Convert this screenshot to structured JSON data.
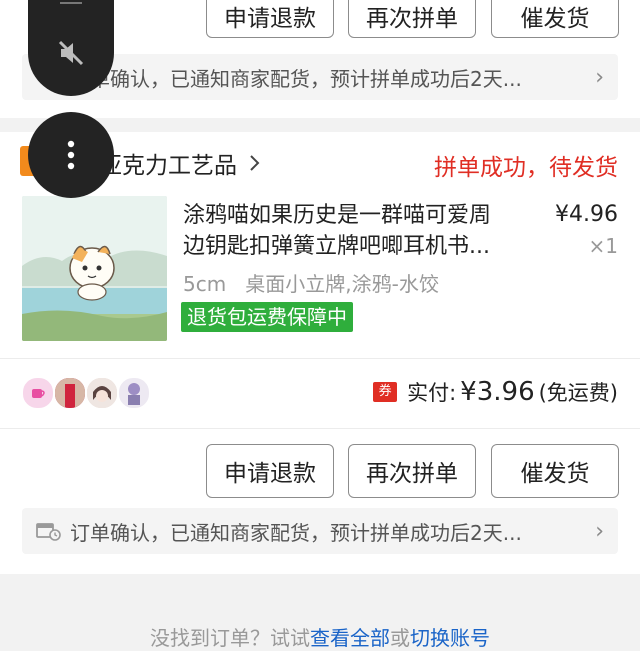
{
  "top_card": {
    "buttons": [
      "申请退款",
      "再次拼单",
      "催发货"
    ],
    "notice": "订单确认，已通知商家配货，预计拼单成功后2天..."
  },
  "order": {
    "shop_name": "米亚克力工艺品",
    "status": "拼单成功，待发货",
    "product": {
      "title_line1": "涂鸦喵如果历史是一群喵可爱周",
      "title_line2": "边钥匙扣弹簧立牌吧唧耳机书...",
      "price": "¥4.96",
      "qty": "×1",
      "spec": "5cm   桌面小立牌,涂鸦-水饺",
      "guarantee": "退货包运费保障中"
    },
    "payment": {
      "coupon_badge": "券",
      "label": "实付:",
      "amount": "¥3.96",
      "shipping": "(免运费)"
    },
    "buttons": [
      "申请退款",
      "再次拼单",
      "催发货"
    ],
    "notice": "订单确认，已通知商家配货，预计拼单成功后2天..."
  },
  "footer": {
    "text_prefix": "没找到订单？试试",
    "link_all": "查看全部",
    "text_mid": "或",
    "link_switch": "切换账号"
  },
  "colors": {
    "status_red": "#e02e24",
    "guarantee_green": "#2fae3c",
    "floater_bg": "#232323"
  }
}
